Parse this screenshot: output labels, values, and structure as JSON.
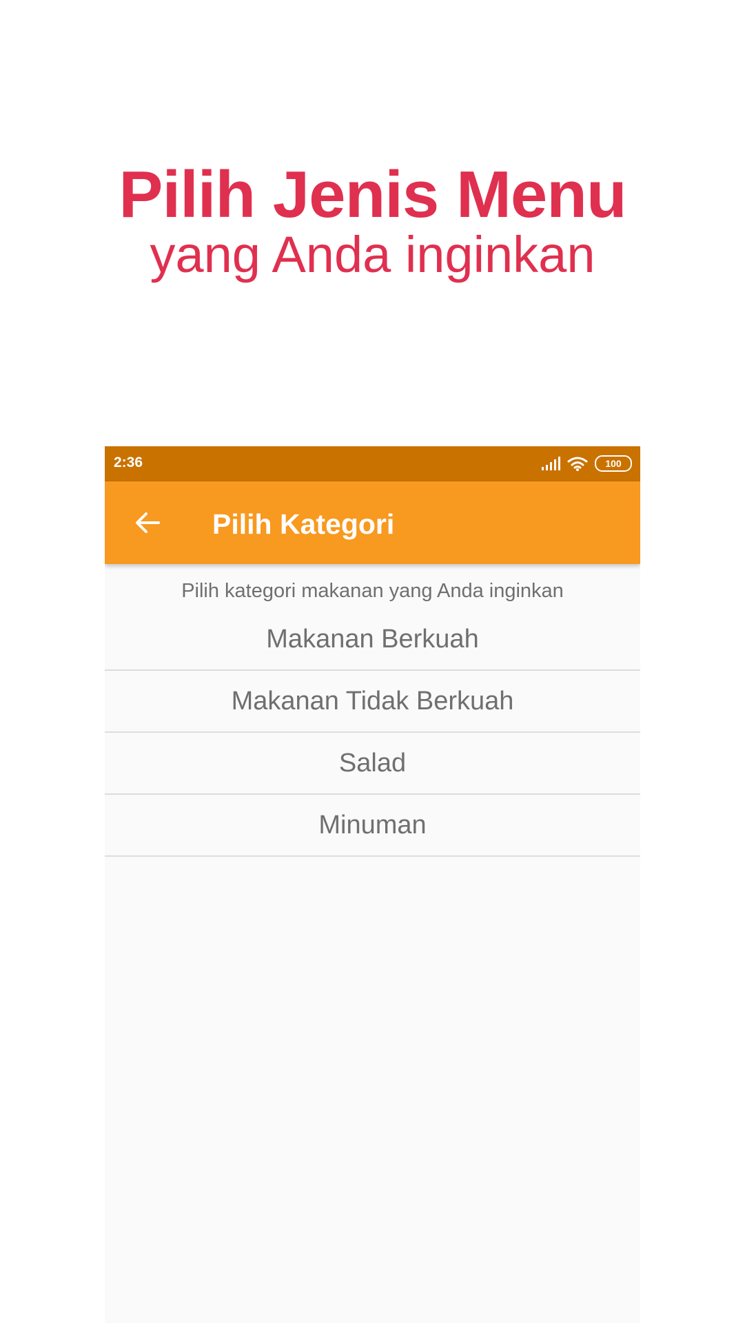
{
  "colors": {
    "promo_text": "#e0304f",
    "status_bar": "#c97200",
    "app_bar": "#f89920"
  },
  "promo": {
    "title": "Pilih Jenis Menu",
    "subtitle": "yang Anda inginkan"
  },
  "status_bar": {
    "time": "2:36",
    "icons": [
      "signal-icon",
      "wifi-icon",
      "battery-icon"
    ],
    "battery_level": "100"
  },
  "app_bar": {
    "back_icon": "arrow-back-icon",
    "title": "Pilih Kategori"
  },
  "content": {
    "hint": "Pilih kategori makanan yang Anda inginkan",
    "categories": [
      {
        "label": "Makanan Berkuah"
      },
      {
        "label": "Makanan Tidak Berkuah"
      },
      {
        "label": "Salad"
      },
      {
        "label": "Minuman"
      }
    ]
  }
}
